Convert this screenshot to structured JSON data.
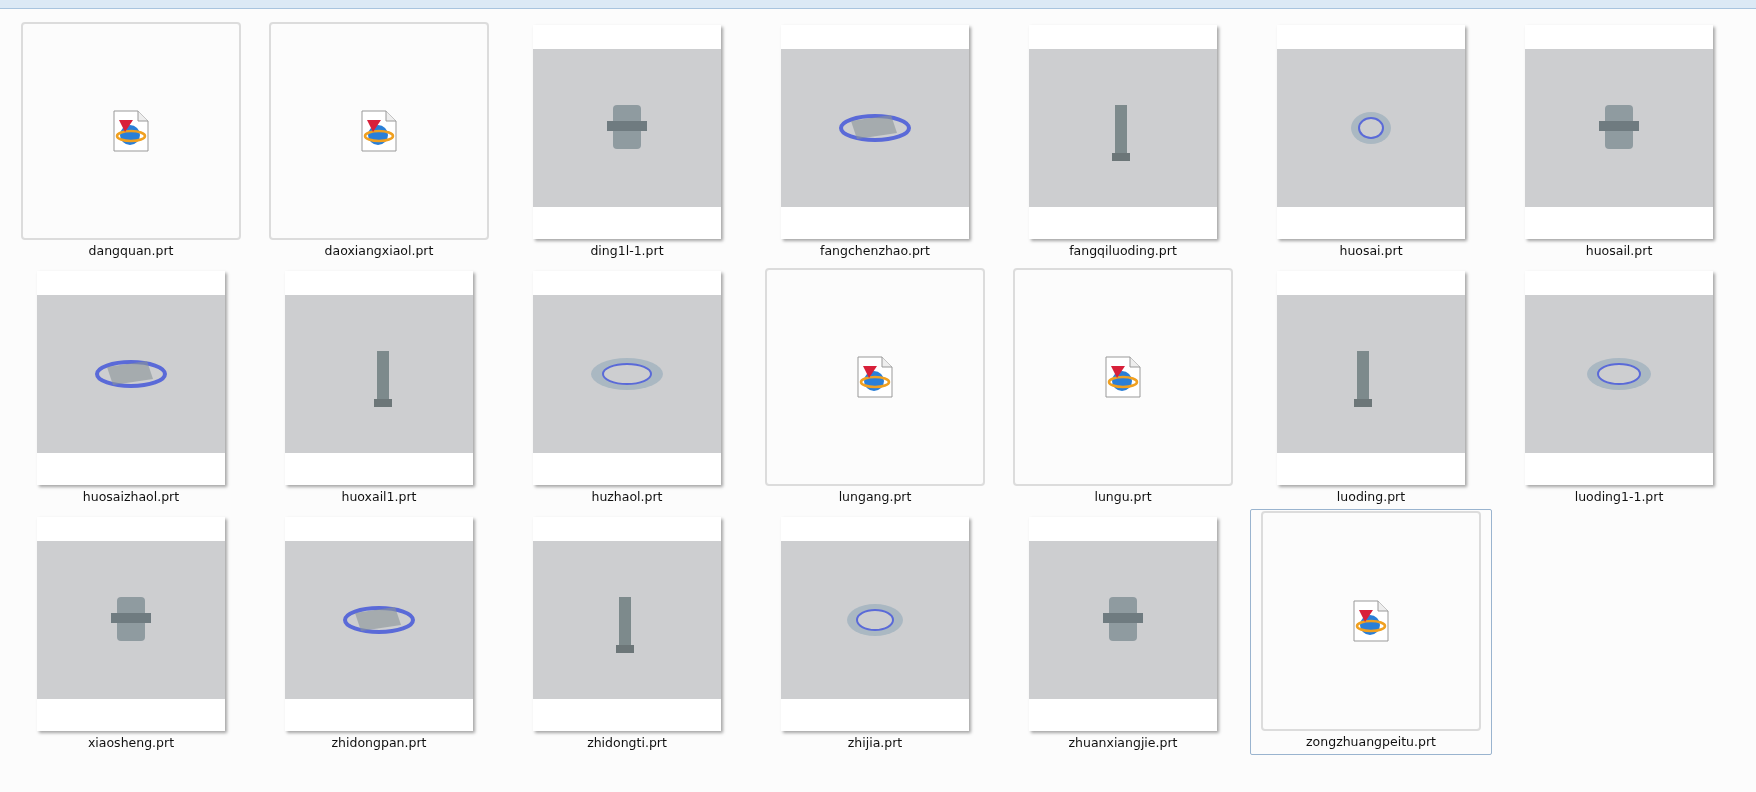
{
  "files": [
    {
      "name": "dangquan.prt",
      "kind": "icon",
      "focused": false
    },
    {
      "name": "daoxiangxiaol.prt",
      "kind": "icon",
      "focused": false
    },
    {
      "name": "ding1l-1.prt",
      "kind": "thumbnail",
      "focused": false
    },
    {
      "name": "fangchenzhao.prt",
      "kind": "thumbnail",
      "focused": false
    },
    {
      "name": "fangqiluoding.prt",
      "kind": "thumbnail",
      "focused": false
    },
    {
      "name": "huosai.prt",
      "kind": "thumbnail",
      "focused": false
    },
    {
      "name": "huosail.prt",
      "kind": "thumbnail",
      "focused": false
    },
    {
      "name": "huosaizhaol.prt",
      "kind": "thumbnail",
      "focused": false
    },
    {
      "name": "huoxail1.prt",
      "kind": "thumbnail",
      "focused": false
    },
    {
      "name": "huzhaol.prt",
      "kind": "thumbnail",
      "focused": false
    },
    {
      "name": "lungang.prt",
      "kind": "icon",
      "focused": false
    },
    {
      "name": "lungu.prt",
      "kind": "icon",
      "focused": false
    },
    {
      "name": "luoding.prt",
      "kind": "thumbnail",
      "focused": false
    },
    {
      "name": "luoding1-1.prt",
      "kind": "thumbnail",
      "focused": false
    },
    {
      "name": "xiaosheng.prt",
      "kind": "thumbnail",
      "focused": false
    },
    {
      "name": "zhidongpan.prt",
      "kind": "thumbnail",
      "focused": false
    },
    {
      "name": "zhidongti.prt",
      "kind": "thumbnail",
      "focused": false
    },
    {
      "name": "zhijia.prt",
      "kind": "thumbnail",
      "focused": false
    },
    {
      "name": "zhuanxiangjie.prt",
      "kind": "thumbnail",
      "focused": false
    },
    {
      "name": "zongzhuangpeitu.prt",
      "kind": "icon",
      "focused": true
    }
  ]
}
